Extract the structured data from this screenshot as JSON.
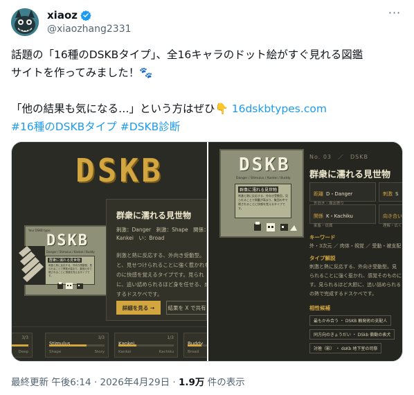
{
  "author": {
    "display_name": "xiaoz",
    "handle": "@xiaozhang2331",
    "verified_color": "#1d9bf0"
  },
  "more_label": "···",
  "tweet": {
    "line1": "話題の「16種のDSKBタイプ」、全16キャラのドット絵がすぐ見れる図鑑",
    "line2": "サイトを作ってみました！🐾",
    "line3_text": "「他の結果も気になる…」という方はぜひ👇 ",
    "line3_link": "16dskbtypes.com",
    "hashtag1": "#16種のDSKBタイプ",
    "hashtag2": "#DSKB診断"
  },
  "left_image": {
    "logo": "DSKB",
    "card_title": "群衆に濡れる見世物",
    "card_meta": "刺激：Danger　刺激：Shape　関係：Kankei　い：Broad",
    "card_desc": "刺激と熱に反応する、外向き受動型。と、見せつけられることに強く惹かれものに快感を覚えるタイプです。見られに、追い詰められるほど身を任せる、成するドスケベです。",
    "btn_detail": "詳細を見る →",
    "btn_share": "結果を X で共有",
    "screen_head": "Your DSKB type:",
    "screen_logo": "DSKB",
    "screen_sub": "Danger / Stimulus / Kankei / Buddy",
    "screen_box_title": "群衆に濡れる見世物",
    "screen_box_text": "刺激と熱に反応する、外向き受動型。見られることで興奮が高まり、集団の中で晒されることに快感を覚えるタイプです。",
    "bars": [
      {
        "name": "",
        "score": "3/3",
        "pole_left": "",
        "pole_right": "Deep",
        "fill": 1.0
      },
      {
        "name": "Stimulus",
        "score": "3/3",
        "pole_left": "Shape",
        "pole_right": "Story",
        "fill": 0.67
      },
      {
        "name": "Kankei",
        "score": "1/3",
        "pole_left": "Kankei",
        "pole_right": "Kachiku",
        "fill": 0.33
      },
      {
        "name": "Buddy",
        "score": "",
        "pole_left": "Broad",
        "pole_right": "",
        "fill": 0.5
      }
    ]
  },
  "right_image": {
    "number": "No. 03　／　DSKB",
    "title": "群衆に濡れる見世物",
    "screen_logo": "DSKB",
    "screen_sub": "Danger / Stimulus / Kankei / Buddy",
    "screen_box_title": "群衆に濡れる見世物",
    "screen_box_text": "刺激と熱に反応する、外向き受動型。見られることで興奮が高まり、集団の中で晒されることに快感を覚えるタイプです。",
    "attrs": [
      {
        "label": "距離",
        "value": "D・Danger",
        "sub": "外向き・露出寄り"
      },
      {
        "label": "刺激",
        "value": "S",
        "sub": ""
      },
      {
        "label": "関係",
        "value": "K・Kachiku",
        "sub": "家畜・従属"
      },
      {
        "label": "向き合い",
        "value": "",
        "sub": "理解・広く"
      }
    ],
    "keyword_title": "キーワード",
    "keyword_text": "外・3次元 ／ 肉体・視覚 ／ 受動・被支配",
    "type_title": "タイプ解説",
    "type_text1": "刺激と熱に反応する、外向き受動型。見",
    "type_text2": "られることに強く惹かれ、感覚そのものに",
    "type_text3": "す。見られるほど大胆に、追い詰められる",
    "type_text4": "の熱で完成するドスケベです。",
    "compat_title": "相性候補",
    "compat": [
      "最もかみ合う ・ DSKB 触発術の支配人",
      "同方向のきょうだい ・ DSkb 衝動の表犬",
      "対極（影） ・ dsKb 地下室の司祭"
    ]
  },
  "meta": {
    "time": "最終更新 午後6:14 · 2026年4月29日 · ",
    "views": "1.9万",
    "views_suffix": " 件の表示"
  },
  "colors": {
    "accent": "#d4a640",
    "panel_bg": "#2b2b25",
    "link": "#1d9bf0"
  }
}
